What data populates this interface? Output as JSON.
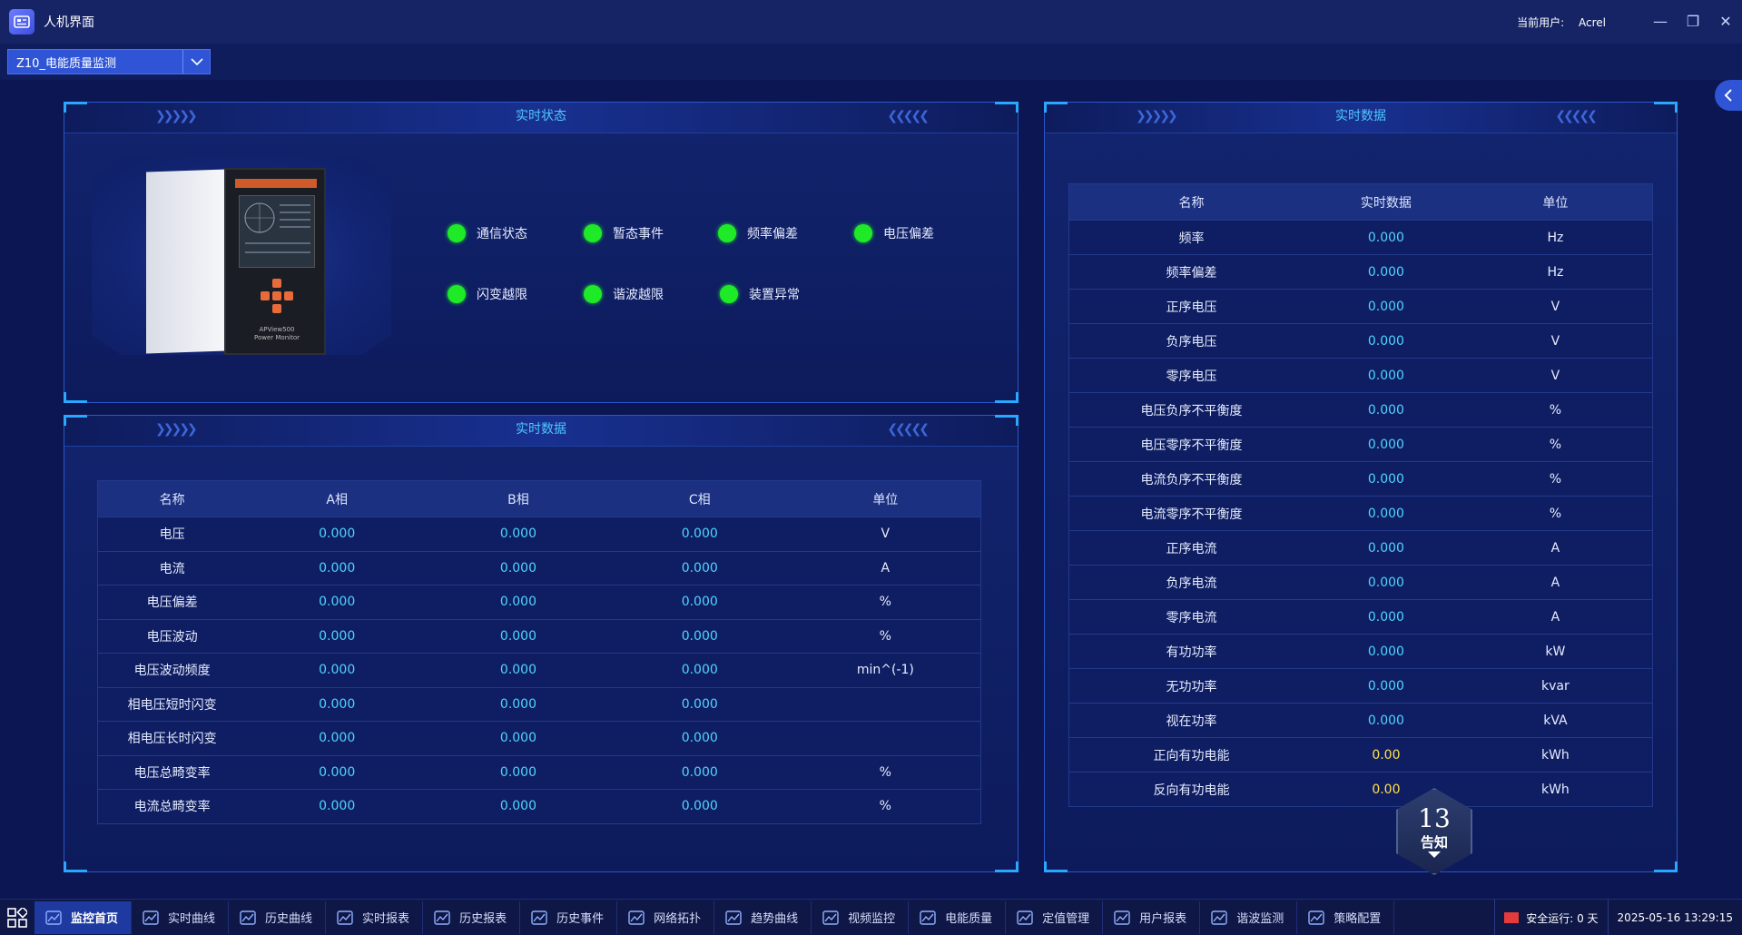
{
  "window": {
    "title": "人机界面",
    "user_label": "当前用户:",
    "user_name": "Acrel"
  },
  "device_select": {
    "value": "Z10_电能质量监测"
  },
  "status_panel": {
    "title": "实时状态",
    "device_label_line1": "APView500",
    "device_label_line2": "Power Monitor",
    "indicators": [
      {
        "label": "通信状态"
      },
      {
        "label": "暂态事件"
      },
      {
        "label": "频率偏差"
      },
      {
        "label": "电压偏差"
      },
      {
        "label": "闪变越限"
      },
      {
        "label": "谐波越限"
      },
      {
        "label": "装置异常"
      }
    ],
    "indicator_color": "#1eea27"
  },
  "phase_panel": {
    "title": "实时数据",
    "headers": [
      "名称",
      "A相",
      "B相",
      "C相",
      "单位"
    ],
    "rows": [
      [
        "电压",
        "0.000",
        "0.000",
        "0.000",
        "V"
      ],
      [
        "电流",
        "0.000",
        "0.000",
        "0.000",
        "A"
      ],
      [
        "电压偏差",
        "0.000",
        "0.000",
        "0.000",
        "%"
      ],
      [
        "电压波动",
        "0.000",
        "0.000",
        "0.000",
        "%"
      ],
      [
        "电压波动频度",
        "0.000",
        "0.000",
        "0.000",
        "min^(-1)"
      ],
      [
        "相电压短时闪变",
        "0.000",
        "0.000",
        "0.000",
        ""
      ],
      [
        "相电压长时闪变",
        "0.000",
        "0.000",
        "0.000",
        ""
      ],
      [
        "电压总畸变率",
        "0.000",
        "0.000",
        "0.000",
        "%"
      ],
      [
        "电流总畸变率",
        "0.000",
        "0.000",
        "0.000",
        "%"
      ]
    ]
  },
  "realtime_panel": {
    "title": "实时数据",
    "headers": [
      "名称",
      "实时数据",
      "单位"
    ],
    "rows": [
      [
        "频率",
        "0.000",
        "Hz"
      ],
      [
        "频率偏差",
        "0.000",
        "Hz"
      ],
      [
        "正序电压",
        "0.000",
        "V"
      ],
      [
        "负序电压",
        "0.000",
        "V"
      ],
      [
        "零序电压",
        "0.000",
        "V"
      ],
      [
        "电压负序不平衡度",
        "0.000",
        "%"
      ],
      [
        "电压零序不平衡度",
        "0.000",
        "%"
      ],
      [
        "电流负序不平衡度",
        "0.000",
        "%"
      ],
      [
        "电流零序不平衡度",
        "0.000",
        "%"
      ],
      [
        "正序电流",
        "0.000",
        "A"
      ],
      [
        "负序电流",
        "0.000",
        "A"
      ],
      [
        "零序电流",
        "0.000",
        "A"
      ],
      [
        "有功功率",
        "0.000",
        "kW"
      ],
      [
        "无功功率",
        "0.000",
        "kvar"
      ],
      [
        "视在功率",
        "0.000",
        "kVA"
      ],
      [
        "正向有功电能",
        "0.00",
        "kWh"
      ],
      [
        "反向有功电能",
        "0.00",
        "kWh"
      ]
    ]
  },
  "notice": {
    "count": "13",
    "label": "告知"
  },
  "taskbar": {
    "items": [
      {
        "label": "监控首页",
        "icon": "home-icon"
      },
      {
        "label": "实时曲线",
        "icon": "line-chart-icon"
      },
      {
        "label": "历史曲线",
        "icon": "history-chart-icon"
      },
      {
        "label": "实时报表",
        "icon": "report-icon"
      },
      {
        "label": "历史报表",
        "icon": "history-report-icon"
      },
      {
        "label": "历史事件",
        "icon": "event-icon"
      },
      {
        "label": "网络拓扑",
        "icon": "topology-icon"
      },
      {
        "label": "趋势曲线",
        "icon": "trend-icon"
      },
      {
        "label": "视频监控",
        "icon": "video-icon"
      },
      {
        "label": "电能质量",
        "icon": "power-quality-icon"
      },
      {
        "label": "定值管理",
        "icon": "setting-value-icon"
      },
      {
        "label": "用户报表",
        "icon": "user-report-icon"
      },
      {
        "label": "谐波监测",
        "icon": "harmonic-icon"
      },
      {
        "label": "策略配置",
        "icon": "strategy-icon"
      }
    ],
    "safe_run": "安全运行: 0 天",
    "datetime": "2025-05-16 13:29:15"
  },
  "colors": {
    "accent": "#4fc7ff",
    "value": "#4fd4ff",
    "energy_value": "#ffe14d",
    "status_ok": "#1eea27"
  }
}
